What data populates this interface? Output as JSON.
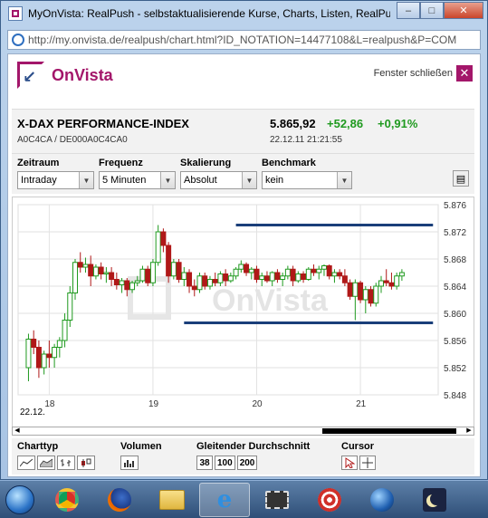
{
  "window": {
    "title": "MyOnVista: RealPush - selbstaktualisierende Kurse, Charts, Listen, RealPush",
    "url": "http://my.onvista.de/realpush/chart.html?ID_NOTATION=14477108&L=realpush&P=COM",
    "minimize_label": "–",
    "maximize_label": "□",
    "close_label": "✕"
  },
  "header": {
    "logo_text": "OnVista",
    "close_window_label": "Fenster schließen",
    "close_icon": "✕"
  },
  "quote": {
    "name": "X-DAX PERFORMANCE-INDEX",
    "wkn": "A0C4CA",
    "isin": "DE000A0C4CA0",
    "ids_separator": " / ",
    "price": "5.865,92",
    "change": "+52,86",
    "change_pct": "+0,91%",
    "datetime": "22.12.11 21:21:55",
    "positive_color": "#1f9a1f"
  },
  "controls": {
    "zeitraum": {
      "label": "Zeitraum",
      "value": "Intraday"
    },
    "frequenz": {
      "label": "Frequenz",
      "value": "5 Minuten"
    },
    "skalierung": {
      "label": "Skalierung",
      "value": "Absolut"
    },
    "benchmark": {
      "label": "Benchmark",
      "value": "kein"
    },
    "dropdown_glyph": "▼",
    "print_glyph": "▤"
  },
  "chart_data": {
    "type": "candlestick",
    "x_tick_labels": [
      "18",
      "19",
      "20",
      "21"
    ],
    "y_tick_labels": [
      "5.876",
      "5.872",
      "5.868",
      "5.864",
      "5.860",
      "5.856",
      "5.852",
      "5.848"
    ],
    "ylim": [
      5.848,
      5.876
    ],
    "date_label": "22.12.",
    "watermark": "OnVista",
    "up_color": "#1f9a1f",
    "down_color": "#b01818",
    "line_color": "#1a3f7a",
    "grid": true,
    "horizontal_lines": [
      {
        "y": 5.873,
        "x_start_hour": 19.8,
        "x_end_hour": 21.7
      },
      {
        "y": 5.8586,
        "x_start_hour": 19.3,
        "x_end_hour": 21.7
      }
    ],
    "candles": [
      {
        "t": 17.8,
        "o": 5.852,
        "h": 5.857,
        "l": 5.85,
        "c": 5.8562
      },
      {
        "t": 17.85,
        "o": 5.8562,
        "h": 5.8575,
        "l": 5.854,
        "c": 5.855
      },
      {
        "t": 17.9,
        "o": 5.855,
        "h": 5.856,
        "l": 5.8505,
        "c": 5.852
      },
      {
        "t": 17.95,
        "o": 5.852,
        "h": 5.8545,
        "l": 5.851,
        "c": 5.854
      },
      {
        "t": 18.0,
        "o": 5.854,
        "h": 5.856,
        "l": 5.852,
        "c": 5.8535
      },
      {
        "t": 18.05,
        "o": 5.8535,
        "h": 5.8555,
        "l": 5.852,
        "c": 5.855
      },
      {
        "t": 18.1,
        "o": 5.855,
        "h": 5.8565,
        "l": 5.8535,
        "c": 5.856
      },
      {
        "t": 18.15,
        "o": 5.856,
        "h": 5.86,
        "l": 5.855,
        "c": 5.859
      },
      {
        "t": 18.2,
        "o": 5.859,
        "h": 5.864,
        "l": 5.858,
        "c": 5.863
      },
      {
        "t": 18.25,
        "o": 5.863,
        "h": 5.868,
        "l": 5.862,
        "c": 5.8675
      },
      {
        "t": 18.3,
        "o": 5.8675,
        "h": 5.869,
        "l": 5.866,
        "c": 5.8668
      },
      {
        "t": 18.35,
        "o": 5.8668,
        "h": 5.8682,
        "l": 5.866,
        "c": 5.8672
      },
      {
        "t": 18.4,
        "o": 5.8672,
        "h": 5.8685,
        "l": 5.864,
        "c": 5.8655
      },
      {
        "t": 18.45,
        "o": 5.8655,
        "h": 5.8672,
        "l": 5.865,
        "c": 5.8668
      },
      {
        "t": 18.5,
        "o": 5.8668,
        "h": 5.8675,
        "l": 5.865,
        "c": 5.8658
      },
      {
        "t": 18.55,
        "o": 5.8658,
        "h": 5.8668,
        "l": 5.8645,
        "c": 5.866
      },
      {
        "t": 18.6,
        "o": 5.866,
        "h": 5.8668,
        "l": 5.864,
        "c": 5.865
      },
      {
        "t": 18.65,
        "o": 5.865,
        "h": 5.866,
        "l": 5.8635,
        "c": 5.8642
      },
      {
        "t": 18.7,
        "o": 5.8642,
        "h": 5.8652,
        "l": 5.863,
        "c": 5.8648
      },
      {
        "t": 18.75,
        "o": 5.8648,
        "h": 5.8652,
        "l": 5.8625,
        "c": 5.8635
      },
      {
        "t": 18.8,
        "o": 5.8635,
        "h": 5.8648,
        "l": 5.863,
        "c": 5.8645
      },
      {
        "t": 18.85,
        "o": 5.8645,
        "h": 5.8655,
        "l": 5.864,
        "c": 5.8648
      },
      {
        "t": 18.9,
        "o": 5.8648,
        "h": 5.867,
        "l": 5.8645,
        "c": 5.8665
      },
      {
        "t": 18.95,
        "o": 5.8665,
        "h": 5.867,
        "l": 5.864,
        "c": 5.8645
      },
      {
        "t": 19.0,
        "o": 5.8645,
        "h": 5.868,
        "l": 5.864,
        "c": 5.8675
      },
      {
        "t": 19.05,
        "o": 5.8675,
        "h": 5.873,
        "l": 5.867,
        "c": 5.872
      },
      {
        "t": 19.1,
        "o": 5.872,
        "h": 5.8725,
        "l": 5.869,
        "c": 5.87
      },
      {
        "t": 19.15,
        "o": 5.87,
        "h": 5.8705,
        "l": 5.8645,
        "c": 5.8655
      },
      {
        "t": 19.2,
        "o": 5.8655,
        "h": 5.868,
        "l": 5.865,
        "c": 5.8675
      },
      {
        "t": 19.25,
        "o": 5.8675,
        "h": 5.868,
        "l": 5.8645,
        "c": 5.865
      },
      {
        "t": 19.3,
        "o": 5.865,
        "h": 5.8668,
        "l": 5.864,
        "c": 5.866
      },
      {
        "t": 19.35,
        "o": 5.866,
        "h": 5.8665,
        "l": 5.863,
        "c": 5.864
      },
      {
        "t": 19.4,
        "o": 5.864,
        "h": 5.865,
        "l": 5.8625,
        "c": 5.8635
      },
      {
        "t": 19.45,
        "o": 5.8635,
        "h": 5.866,
        "l": 5.863,
        "c": 5.8655
      },
      {
        "t": 19.5,
        "o": 5.8655,
        "h": 5.866,
        "l": 5.8635,
        "c": 5.864
      },
      {
        "t": 19.55,
        "o": 5.864,
        "h": 5.8655,
        "l": 5.8635,
        "c": 5.865
      },
      {
        "t": 19.6,
        "o": 5.865,
        "h": 5.866,
        "l": 5.864,
        "c": 5.8645
      },
      {
        "t": 19.65,
        "o": 5.8645,
        "h": 5.8662,
        "l": 5.864,
        "c": 5.8658
      },
      {
        "t": 19.7,
        "o": 5.8658,
        "h": 5.8665,
        "l": 5.864,
        "c": 5.8648
      },
      {
        "t": 19.75,
        "o": 5.8648,
        "h": 5.866,
        "l": 5.8645,
        "c": 5.8655
      },
      {
        "t": 19.8,
        "o": 5.8655,
        "h": 5.8668,
        "l": 5.865,
        "c": 5.8665
      },
      {
        "t": 19.85,
        "o": 5.8665,
        "h": 5.8678,
        "l": 5.866,
        "c": 5.8672
      },
      {
        "t": 19.9,
        "o": 5.8672,
        "h": 5.8675,
        "l": 5.8655,
        "c": 5.866
      },
      {
        "t": 19.95,
        "o": 5.866,
        "h": 5.8668,
        "l": 5.865,
        "c": 5.8665
      },
      {
        "t": 20.0,
        "o": 5.8665,
        "h": 5.867,
        "l": 5.8645,
        "c": 5.865
      },
      {
        "t": 20.05,
        "o": 5.865,
        "h": 5.866,
        "l": 5.864,
        "c": 5.8655
      },
      {
        "t": 20.1,
        "o": 5.8655,
        "h": 5.8662,
        "l": 5.8645,
        "c": 5.8648
      },
      {
        "t": 20.15,
        "o": 5.8648,
        "h": 5.8662,
        "l": 5.864,
        "c": 5.866
      },
      {
        "t": 20.2,
        "o": 5.866,
        "h": 5.8665,
        "l": 5.8645,
        "c": 5.865
      },
      {
        "t": 20.25,
        "o": 5.865,
        "h": 5.866,
        "l": 5.864,
        "c": 5.8655
      },
      {
        "t": 20.3,
        "o": 5.8655,
        "h": 5.867,
        "l": 5.865,
        "c": 5.8665
      },
      {
        "t": 20.35,
        "o": 5.8665,
        "h": 5.867,
        "l": 5.864,
        "c": 5.8648
      },
      {
        "t": 20.4,
        "o": 5.8648,
        "h": 5.8662,
        "l": 5.8645,
        "c": 5.8658
      },
      {
        "t": 20.45,
        "o": 5.8658,
        "h": 5.8662,
        "l": 5.8645,
        "c": 5.865
      },
      {
        "t": 20.5,
        "o": 5.865,
        "h": 5.8668,
        "l": 5.8648,
        "c": 5.8665
      },
      {
        "t": 20.55,
        "o": 5.8665,
        "h": 5.8672,
        "l": 5.8655,
        "c": 5.866
      },
      {
        "t": 20.6,
        "o": 5.866,
        "h": 5.867,
        "l": 5.865,
        "c": 5.8665
      },
      {
        "t": 20.65,
        "o": 5.8665,
        "h": 5.8672,
        "l": 5.8655,
        "c": 5.867
      },
      {
        "t": 20.7,
        "o": 5.867,
        "h": 5.8672,
        "l": 5.865,
        "c": 5.8655
      },
      {
        "t": 20.75,
        "o": 5.8655,
        "h": 5.8665,
        "l": 5.8645,
        "c": 5.866
      },
      {
        "t": 20.8,
        "o": 5.866,
        "h": 5.8665,
        "l": 5.865,
        "c": 5.8655
      },
      {
        "t": 20.85,
        "o": 5.8655,
        "h": 5.8665,
        "l": 5.864,
        "c": 5.8645
      },
      {
        "t": 20.9,
        "o": 5.8645,
        "h": 5.865,
        "l": 5.862,
        "c": 5.8625
      },
      {
        "t": 20.95,
        "o": 5.8625,
        "h": 5.865,
        "l": 5.859,
        "c": 5.8645
      },
      {
        "t": 21.0,
        "o": 5.8645,
        "h": 5.8648,
        "l": 5.8615,
        "c": 5.862
      },
      {
        "t": 21.05,
        "o": 5.862,
        "h": 5.864,
        "l": 5.86,
        "c": 5.8635
      },
      {
        "t": 21.1,
        "o": 5.8635,
        "h": 5.864,
        "l": 5.861,
        "c": 5.8615
      },
      {
        "t": 21.15,
        "o": 5.8615,
        "h": 5.8645,
        "l": 5.861,
        "c": 5.864
      },
      {
        "t": 21.2,
        "o": 5.864,
        "h": 5.8655,
        "l": 5.863,
        "c": 5.8648
      },
      {
        "t": 21.25,
        "o": 5.8648,
        "h": 5.8665,
        "l": 5.864,
        "c": 5.8645
      },
      {
        "t": 21.3,
        "o": 5.8645,
        "h": 5.866,
        "l": 5.8635,
        "c": 5.864
      },
      {
        "t": 21.35,
        "o": 5.864,
        "h": 5.866,
        "l": 5.8635,
        "c": 5.8655
      },
      {
        "t": 21.4,
        "o": 5.8655,
        "h": 5.8665,
        "l": 5.8648,
        "c": 5.866
      }
    ]
  },
  "tools": {
    "charttyp": {
      "label": "Charttyp",
      "icons": [
        "line-chart-icon",
        "mountain-chart-icon",
        "ohlc-chart-icon",
        "candle-chart-icon"
      ]
    },
    "volumen": {
      "label": "Volumen",
      "icon": "volume-bars-icon"
    },
    "gleitender": {
      "label": "Gleitender Durchschnitt",
      "buttons": [
        "38",
        "100",
        "200"
      ]
    },
    "cursor": {
      "label": "Cursor",
      "icons": [
        "arrow-cursor-icon",
        "crosshair-icon"
      ]
    }
  },
  "taskbar": {
    "items": [
      "windows-start-icon",
      "chrome-icon",
      "firefox-icon",
      "explorer-folder-icon",
      "internet-explorer-icon",
      "film-icon",
      "radar-app-icon",
      "google-earth-icon",
      "moon-app-icon"
    ]
  }
}
